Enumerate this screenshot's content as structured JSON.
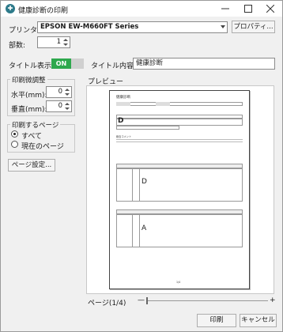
{
  "window": {
    "title": "健康診断の印刷",
    "minimize": "—",
    "maximize": "□",
    "close": "✕"
  },
  "printer": {
    "label": "プリンタ:",
    "value": "EPSON EW-M660FT Series",
    "properties_button": "プロパティ..."
  },
  "copies": {
    "label": "部数:",
    "value": "1"
  },
  "title_display": {
    "label": "タイトル表示:",
    "toggle": "ON"
  },
  "title_content": {
    "label": "タイトル内容:",
    "value": "健康診断"
  },
  "adjust": {
    "group": "印刷微調整",
    "horizontal_label": "水平(mm):",
    "horizontal_value": "0",
    "vertical_label": "垂直(mm):",
    "vertical_value": "0"
  },
  "pages": {
    "group": "印刷するページ",
    "all": "すべて",
    "current": "現在のページ"
  },
  "page_setup_button": "ページ設定...",
  "preview": {
    "label": "プレビュー",
    "page_indicator": "ページ(1/4)",
    "zoom_minus": "—",
    "zoom_plus": "+",
    "doc": {
      "title": "健康診断",
      "judgement": "D",
      "section_comment": "総合コメント",
      "grade_1": "D",
      "grade_2": "A",
      "page_num": "1/4"
    }
  },
  "buttons": {
    "print": "印刷",
    "cancel": "キャンセル"
  }
}
